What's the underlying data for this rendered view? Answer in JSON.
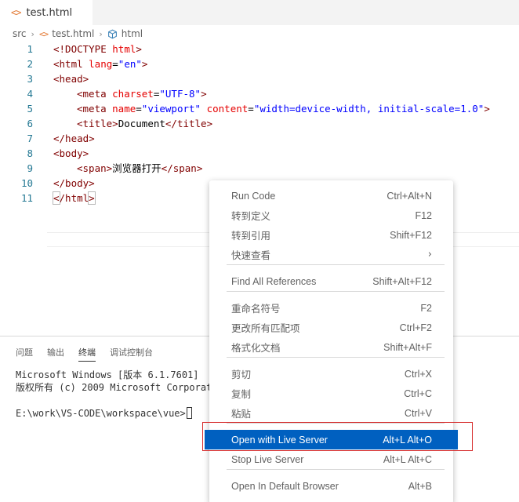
{
  "tab": {
    "label": "test.html",
    "icon": "html-tag-icon"
  },
  "breadcrumb": {
    "folder": "src",
    "file": "test.html",
    "symbol": "html"
  },
  "editor": {
    "line_numbers": [
      "1",
      "2",
      "3",
      "4",
      "5",
      "6",
      "7",
      "8",
      "9",
      "10",
      "11"
    ],
    "lines": [
      [
        {
          "t": "<!DOCTYPE ",
          "c": "tg"
        },
        {
          "t": "html",
          "c": "at"
        },
        {
          "t": ">",
          "c": "tg"
        }
      ],
      [
        {
          "t": "<html ",
          "c": "tg"
        },
        {
          "t": "lang",
          "c": "at"
        },
        {
          "t": "=",
          "c": "tx"
        },
        {
          "t": "\"en\"",
          "c": "st"
        },
        {
          "t": ">",
          "c": "tg"
        }
      ],
      [
        {
          "t": "<head>",
          "c": "tg"
        }
      ],
      [
        {
          "t": "<meta ",
          "c": "tg"
        },
        {
          "t": "charset",
          "c": "at"
        },
        {
          "t": "=",
          "c": "tx"
        },
        {
          "t": "\"UTF-8\"",
          "c": "st"
        },
        {
          "t": ">",
          "c": "tg"
        }
      ],
      [
        {
          "t": "<meta ",
          "c": "tg"
        },
        {
          "t": "name",
          "c": "at"
        },
        {
          "t": "=",
          "c": "tx"
        },
        {
          "t": "\"viewport\"",
          "c": "st"
        },
        {
          "t": " ",
          "c": "tx"
        },
        {
          "t": "content",
          "c": "at"
        },
        {
          "t": "=",
          "c": "tx"
        },
        {
          "t": "\"width=device-width, initial-scale=1.0\"",
          "c": "st"
        },
        {
          "t": ">",
          "c": "tg"
        }
      ],
      [
        {
          "t": "<title>",
          "c": "tg"
        },
        {
          "t": "Document",
          "c": "tx"
        },
        {
          "t": "</title>",
          "c": "tg"
        }
      ],
      [
        {
          "t": "</head>",
          "c": "tg"
        }
      ],
      [
        {
          "t": "<body>",
          "c": "tg"
        }
      ],
      [
        {
          "t": "<span>",
          "c": "tg"
        },
        {
          "t": "浏览器打开",
          "c": "tx"
        },
        {
          "t": "</span>",
          "c": "tg"
        }
      ],
      [
        {
          "t": "</body>",
          "c": "tg"
        }
      ],
      [
        {
          "t": "<",
          "c": "tg"
        },
        {
          "t": "/html",
          "c": "tg"
        },
        {
          "t": ">",
          "c": "tg"
        }
      ]
    ]
  },
  "panel": {
    "tabs": [
      "问题",
      "输出",
      "终端",
      "调试控制台"
    ],
    "active_tab": "终端",
    "terminal_lines": [
      "Microsoft Windows [版本 6.1.7601]",
      "版权所有 (c) 2009 Microsoft Corporat",
      "",
      "E:\\work\\VS-CODE\\workspace\\vue>"
    ]
  },
  "context_menu": {
    "items": [
      {
        "label": "Run Code",
        "shortcut": "Ctrl+Alt+N"
      },
      {
        "label": "转到定义",
        "shortcut": "F12"
      },
      {
        "label": "转到引用",
        "shortcut": "Shift+F12"
      },
      {
        "label": "快速查看",
        "shortcut": "",
        "submenu": true
      },
      {
        "label": "Find All References",
        "shortcut": "Shift+Alt+F12"
      },
      {
        "label": "重命名符号",
        "shortcut": "F2"
      },
      {
        "label": "更改所有匹配项",
        "shortcut": "Ctrl+F2"
      },
      {
        "label": "格式化文档",
        "shortcut": "Shift+Alt+F"
      },
      {
        "label": "剪切",
        "shortcut": "Ctrl+X"
      },
      {
        "label": "复制",
        "shortcut": "Ctrl+C"
      },
      {
        "label": "粘贴",
        "shortcut": "Ctrl+V"
      },
      {
        "label": "Open with Live Server",
        "shortcut": "Alt+L Alt+O",
        "active": true
      },
      {
        "label": "Stop Live Server",
        "shortcut": "Alt+L Alt+C"
      },
      {
        "label": "Open In Default Browser",
        "shortcut": "Alt+B"
      }
    ]
  },
  "colors": {
    "menu_highlight": "#0060c0",
    "annotation_border": "#d62a2a",
    "tag": "#800000",
    "attribute": "#e50000",
    "string": "#0000ff",
    "line_number": "#237893"
  }
}
